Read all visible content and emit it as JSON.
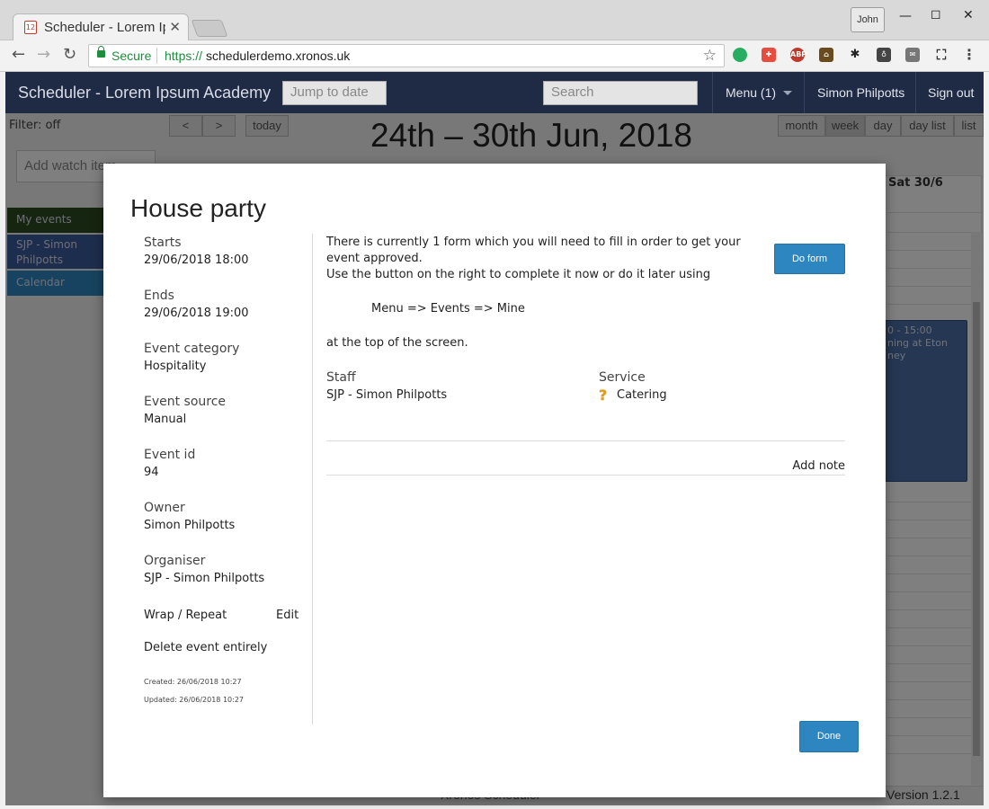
{
  "browser": {
    "tab_title": "Scheduler - Lorem Ipsum Academy",
    "profile_name": "John",
    "secure_label": "Secure",
    "url_scheme": "https://",
    "url_host": "schedulerdemo.xronos.uk"
  },
  "app": {
    "brand": "Scheduler - Lorem Ipsum Academy",
    "jump_placeholder": "Jump to date",
    "search_placeholder": "Search",
    "menu_label": "Menu (1)",
    "user_name": "Simon Philpotts",
    "sign_out": "Sign out"
  },
  "calendar": {
    "filter": "Filter: off",
    "prev": "<",
    "next": ">",
    "today": "today",
    "title": "24th – 30th Jun, 2018",
    "views": [
      "month",
      "week",
      "day",
      "day list",
      "list"
    ],
    "active_view": "week",
    "watch_placeholder": "Add watch item",
    "day_header": "Sat 30/6",
    "bg_event_time": "0 - 15:00",
    "bg_event_text": "ning at Eton\nney",
    "sidebar": [
      "My events",
      "SJP - Simon Philpotts",
      "Calendar"
    ],
    "footer_left": "Xronos Scheduler",
    "version": "Version 1.2.1"
  },
  "modal": {
    "title": "House party",
    "fields": [
      {
        "label": "Starts",
        "value": "29/06/2018 18:00"
      },
      {
        "label": "Ends",
        "value": "29/06/2018 19:00"
      },
      {
        "label": "Event category",
        "value": "Hospitality"
      },
      {
        "label": "Event source",
        "value": "Manual"
      },
      {
        "label": "Event id",
        "value": "94"
      },
      {
        "label": "Owner",
        "value": "Simon Philpotts"
      },
      {
        "label": "Organiser",
        "value": "SJP - Simon Philpotts"
      }
    ],
    "wrap_repeat": "Wrap / Repeat",
    "edit": "Edit",
    "delete": "Delete event entirely",
    "created": "Created: 26/06/2018 10:27",
    "updated": "Updated: 26/06/2018 10:27",
    "form_text_1": "There is currently 1 form which you will need to fill in order to get your",
    "form_text_2": "event approved.",
    "form_text_3": "Use the button on the right to complete it now or do it later using",
    "menu_path": "Menu => Events => Mine",
    "form_text_4": "at the top of the screen.",
    "do_form": "Do form",
    "staff_label": "Staff",
    "staff_value": "SJP - Simon Philpotts",
    "service_label": "Service",
    "service_value": "Catering",
    "service_icon": "question-icon",
    "add_note": "Add note",
    "done": "Done"
  },
  "colors": {
    "nav_bg": "#1f2a44",
    "button_blue": "#2e86c1",
    "secure_green": "#1e8e3e"
  }
}
